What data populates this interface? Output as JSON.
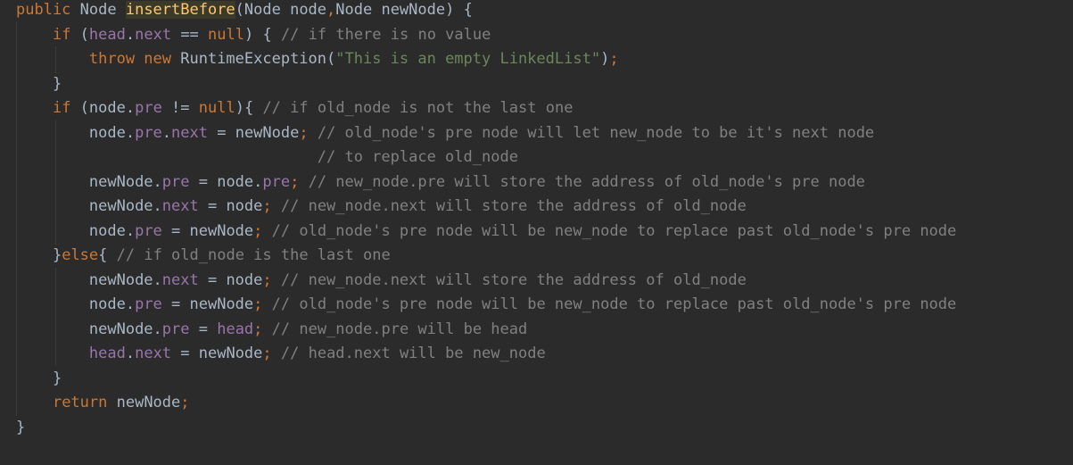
{
  "editor": {
    "colors": {
      "background": "#2b2b2b",
      "plain": "#a9b7c6",
      "keyword": "#cc7832",
      "method_declaration": "#ffc66d",
      "field": "#9876aa",
      "string": "#6a8759",
      "comment": "#808080",
      "method_highlight": "#3b3a28"
    },
    "lines": [
      {
        "indent": 0,
        "tokens": [
          {
            "t": "kw",
            "v": "public"
          },
          {
            "t": "plain",
            "v": " Node "
          },
          {
            "t": "fn",
            "v": "insertBefore"
          },
          {
            "t": "plain",
            "v": "(Node node"
          },
          {
            "t": "kw",
            "v": ","
          },
          {
            "t": "plain",
            "v": "Node newNode) {"
          }
        ]
      },
      {
        "indent": 1,
        "tokens": [
          {
            "t": "kw",
            "v": "if"
          },
          {
            "t": "plain",
            "v": " ("
          },
          {
            "t": "field",
            "v": "head"
          },
          {
            "t": "plain",
            "v": "."
          },
          {
            "t": "field",
            "v": "next"
          },
          {
            "t": "plain",
            "v": " == "
          },
          {
            "t": "kw",
            "v": "null"
          },
          {
            "t": "plain",
            "v": ") { "
          },
          {
            "t": "cm",
            "v": "// if there is no value"
          }
        ]
      },
      {
        "indent": 2,
        "tokens": [
          {
            "t": "kw",
            "v": "throw new"
          },
          {
            "t": "plain",
            "v": " RuntimeException("
          },
          {
            "t": "str",
            "v": "\"This is an empty LinkedList\""
          },
          {
            "t": "plain",
            "v": ")"
          },
          {
            "t": "kw",
            "v": ";"
          }
        ]
      },
      {
        "indent": 1,
        "tokens": [
          {
            "t": "plain",
            "v": "}"
          }
        ]
      },
      {
        "indent": 1,
        "tokens": [
          {
            "t": "kw",
            "v": "if"
          },
          {
            "t": "plain",
            "v": " (node."
          },
          {
            "t": "field",
            "v": "pre"
          },
          {
            "t": "plain",
            "v": " != "
          },
          {
            "t": "kw",
            "v": "null"
          },
          {
            "t": "plain",
            "v": "){ "
          },
          {
            "t": "cm",
            "v": "// if old_node is not the last one"
          }
        ]
      },
      {
        "indent": 2,
        "tokens": [
          {
            "t": "plain",
            "v": "node."
          },
          {
            "t": "field",
            "v": "pre"
          },
          {
            "t": "plain",
            "v": "."
          },
          {
            "t": "field",
            "v": "next"
          },
          {
            "t": "plain",
            "v": " = newNode"
          },
          {
            "t": "kw",
            "v": ";"
          },
          {
            "t": "cm",
            "v": " // old_node's pre node will let new_node to be it's next node"
          }
        ]
      },
      {
        "indent": 2,
        "tokens": [
          {
            "t": "plain",
            "v": "                         "
          },
          {
            "t": "cm",
            "v": "// to replace old_node"
          }
        ]
      },
      {
        "indent": 2,
        "tokens": [
          {
            "t": "plain",
            "v": "newNode."
          },
          {
            "t": "field",
            "v": "pre"
          },
          {
            "t": "plain",
            "v": " = node."
          },
          {
            "t": "field",
            "v": "pre"
          },
          {
            "t": "kw",
            "v": ";"
          },
          {
            "t": "cm",
            "v": " // new_node.pre will store the address of old_node's pre node"
          }
        ]
      },
      {
        "indent": 2,
        "tokens": [
          {
            "t": "plain",
            "v": "newNode."
          },
          {
            "t": "field",
            "v": "next"
          },
          {
            "t": "plain",
            "v": " = node"
          },
          {
            "t": "kw",
            "v": ";"
          },
          {
            "t": "cm",
            "v": " // new_node.next will store the address of old_node"
          }
        ]
      },
      {
        "indent": 2,
        "tokens": [
          {
            "t": "plain",
            "v": "node."
          },
          {
            "t": "field",
            "v": "pre"
          },
          {
            "t": "plain",
            "v": " = newNode"
          },
          {
            "t": "kw",
            "v": ";"
          },
          {
            "t": "cm",
            "v": " // old_node's pre node will be new_node to replace past old_node's pre node"
          }
        ]
      },
      {
        "indent": 1,
        "tokens": [
          {
            "t": "plain",
            "v": "}"
          },
          {
            "t": "kw",
            "v": "else"
          },
          {
            "t": "plain",
            "v": "{ "
          },
          {
            "t": "cm",
            "v": "// if old_node is the last one"
          }
        ]
      },
      {
        "indent": 2,
        "tokens": [
          {
            "t": "plain",
            "v": "newNode."
          },
          {
            "t": "field",
            "v": "next"
          },
          {
            "t": "plain",
            "v": " = node"
          },
          {
            "t": "kw",
            "v": ";"
          },
          {
            "t": "cm",
            "v": " // new_node.next will store the address of old_node"
          }
        ]
      },
      {
        "indent": 2,
        "tokens": [
          {
            "t": "plain",
            "v": "node."
          },
          {
            "t": "field",
            "v": "pre"
          },
          {
            "t": "plain",
            "v": " = newNode"
          },
          {
            "t": "kw",
            "v": ";"
          },
          {
            "t": "cm",
            "v": " // old_node's pre node will be new_node to replace past old_node's pre node"
          }
        ]
      },
      {
        "indent": 2,
        "tokens": [
          {
            "t": "plain",
            "v": "newNode."
          },
          {
            "t": "field",
            "v": "pre"
          },
          {
            "t": "plain",
            "v": " = "
          },
          {
            "t": "field",
            "v": "head"
          },
          {
            "t": "kw",
            "v": ";"
          },
          {
            "t": "cm",
            "v": " // new_node.pre will be head"
          }
        ]
      },
      {
        "indent": 2,
        "tokens": [
          {
            "t": "field",
            "v": "head"
          },
          {
            "t": "plain",
            "v": "."
          },
          {
            "t": "field",
            "v": "next"
          },
          {
            "t": "plain",
            "v": " = newNode"
          },
          {
            "t": "kw",
            "v": ";"
          },
          {
            "t": "cm",
            "v": " // head.next will be new_node"
          }
        ]
      },
      {
        "indent": 1,
        "tokens": [
          {
            "t": "plain",
            "v": "}"
          }
        ]
      },
      {
        "indent": 1,
        "tokens": [
          {
            "t": "kw",
            "v": "return"
          },
          {
            "t": "plain",
            "v": " newNode"
          },
          {
            "t": "kw",
            "v": ";"
          }
        ]
      },
      {
        "indent": 0,
        "tokens": [
          {
            "t": "plain",
            "v": "}"
          }
        ]
      }
    ]
  }
}
